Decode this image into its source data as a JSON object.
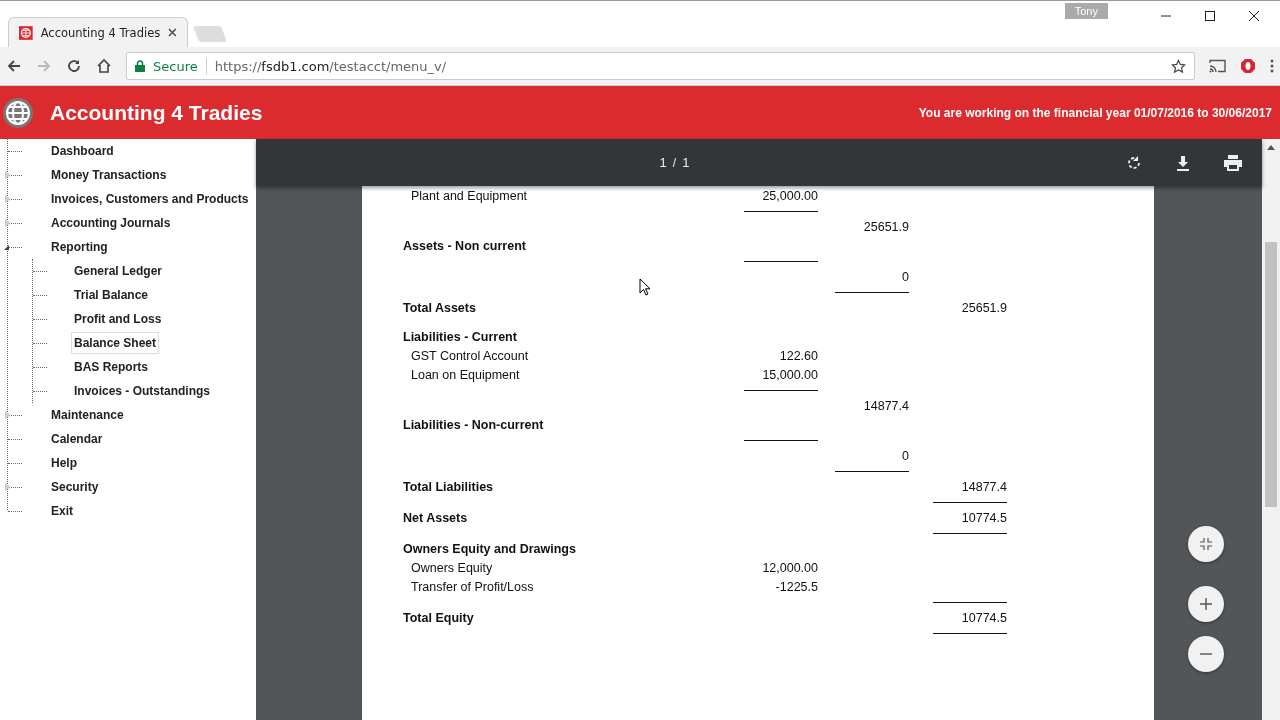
{
  "browser": {
    "tab_title": "Accounting 4 Tradies",
    "profile": "Tony",
    "secure_label": "Secure",
    "url_scheme": "https://",
    "url_host": "fsdb1.com",
    "url_path": "/testacct/menu_v/"
  },
  "header": {
    "title": "Accounting 4 Tradies",
    "financial_year": "You are working on the financial year 01/07/2016 to 30/06/2017"
  },
  "sidebar": {
    "items": [
      {
        "label": "Dashboard",
        "kind": "leaf",
        "selected": false
      },
      {
        "label": "Money Transactions",
        "kind": "folder",
        "expanded": false,
        "selected": false
      },
      {
        "label": "Invoices, Customers and Products",
        "kind": "folder",
        "expanded": false,
        "selected": false
      },
      {
        "label": "Accounting Journals",
        "kind": "folder",
        "expanded": false,
        "selected": false
      },
      {
        "label": "Reporting",
        "kind": "folder",
        "expanded": true,
        "selected": false,
        "children": [
          {
            "label": "General Ledger",
            "selected": false
          },
          {
            "label": "Trial Balance",
            "selected": false
          },
          {
            "label": "Profit and Loss",
            "selected": false
          },
          {
            "label": "Balance Sheet",
            "selected": true
          },
          {
            "label": "BAS Reports",
            "selected": false
          },
          {
            "label": "Invoices - Outstandings",
            "selected": false
          }
        ]
      },
      {
        "label": "Maintenance",
        "kind": "folder",
        "expanded": false,
        "selected": false
      },
      {
        "label": "Calendar",
        "kind": "leaf",
        "selected": false
      },
      {
        "label": "Help",
        "kind": "leaf",
        "selected": false
      },
      {
        "label": "Security",
        "kind": "folder",
        "expanded": false,
        "selected": false
      },
      {
        "label": "Exit",
        "kind": "leaf",
        "selected": false
      }
    ]
  },
  "pdf_viewer": {
    "page": "1",
    "separator": "/",
    "page_count": "1",
    "rows": [
      {
        "kind": "item",
        "label": "Plant and Equipment",
        "c1": "25,000.00"
      },
      {
        "kind": "rule",
        "c1": true,
        "c2": false,
        "c3": false
      },
      {
        "kind": "amount",
        "c2": "25651.9"
      },
      {
        "kind": "section",
        "label": "Assets - Non current"
      },
      {
        "kind": "rule",
        "c1": true,
        "c2": false,
        "c3": false
      },
      {
        "kind": "amount",
        "c2": "0"
      },
      {
        "kind": "rule",
        "c1": false,
        "c2": true,
        "c3": false
      },
      {
        "kind": "section",
        "label": "Total Assets",
        "c3": "25651.9"
      },
      {
        "kind": "space"
      },
      {
        "kind": "section",
        "label": "Liabilities - Current"
      },
      {
        "kind": "item",
        "label": "GST Control Account",
        "c1": "122.60"
      },
      {
        "kind": "item",
        "label": "Loan on Equipment",
        "c1": "15,000.00"
      },
      {
        "kind": "rule",
        "c1": true,
        "c2": false,
        "c3": false
      },
      {
        "kind": "amount",
        "c2": "14877.4"
      },
      {
        "kind": "section",
        "label": "Liabilities - Non-current"
      },
      {
        "kind": "rule",
        "c1": true,
        "c2": false,
        "c3": false
      },
      {
        "kind": "amount",
        "c2": "0"
      },
      {
        "kind": "rule",
        "c1": false,
        "c2": true,
        "c3": false
      },
      {
        "kind": "section",
        "label": "Total Liabilities",
        "c3": "14877.4"
      },
      {
        "kind": "rule",
        "c1": false,
        "c2": false,
        "c3": true
      },
      {
        "kind": "section",
        "label": "Net Assets",
        "c3": "10774.5"
      },
      {
        "kind": "rule",
        "c1": false,
        "c2": false,
        "c3": true
      },
      {
        "kind": "section",
        "label": "Owners Equity and Drawings"
      },
      {
        "kind": "item",
        "label": "Owners Equity",
        "c1": "12,000.00"
      },
      {
        "kind": "item",
        "label": "Transfer of Profit/Loss",
        "c1": "-1225.5"
      },
      {
        "kind": "rule",
        "c1": false,
        "c2": false,
        "c3": true
      },
      {
        "kind": "section",
        "label": "Total Equity",
        "c3": "10774.5"
      },
      {
        "kind": "rule",
        "c1": false,
        "c2": false,
        "c3": true
      }
    ]
  }
}
